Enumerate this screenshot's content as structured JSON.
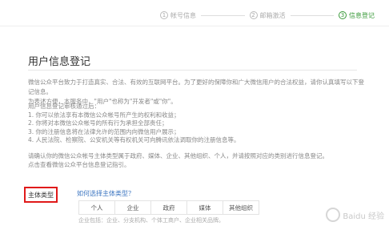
{
  "steps": [
    {
      "num": "1",
      "label": "帐号信息"
    },
    {
      "num": "2",
      "label": "邮箱激活"
    },
    {
      "num": "3",
      "label": "信息登记"
    }
  ],
  "title": "用户信息登记",
  "intro": [
    "微信公众平台致力于打造真实、合法、有效的互联网平台。为了更好的保障你和广大微信用户的合法权益，请你认真填写以下登记信息。",
    "为表述方便，本服务中，\"用户\"也称为\"开发者\"或\"你\"。"
  ],
  "rules": [
    "用户信息登记审核通过后：",
    "1. 你可以依法享有本微信公众帐号所产生的权利和收益；",
    "2. 你将对本微信公众帐号的所有行为承担全部责任；",
    "3. 你的注册信息将在法律允许的范围内向微信用户展示；",
    "4. 人民法院、检察院、公安机关等有权机关可向腾讯依法调取你的注册信息等。"
  ],
  "notice": [
    "请确认你的微信公众帐号主体类型属于政府、媒体、企业、其他组织、个人，并请按照对应的类别进行信息登记。",
    "点击查看微信公众平台信息登记指引。"
  ],
  "subject_type": {
    "label": "主体类型",
    "help_link": "如何选择主体类型？",
    "options": [
      "个人",
      "企业",
      "政府",
      "媒体",
      "其他组织"
    ],
    "hint": "企业包括：企业、分支机构、个体工商户、企业相关品牌。"
  },
  "watermark": "Baidu 经验"
}
